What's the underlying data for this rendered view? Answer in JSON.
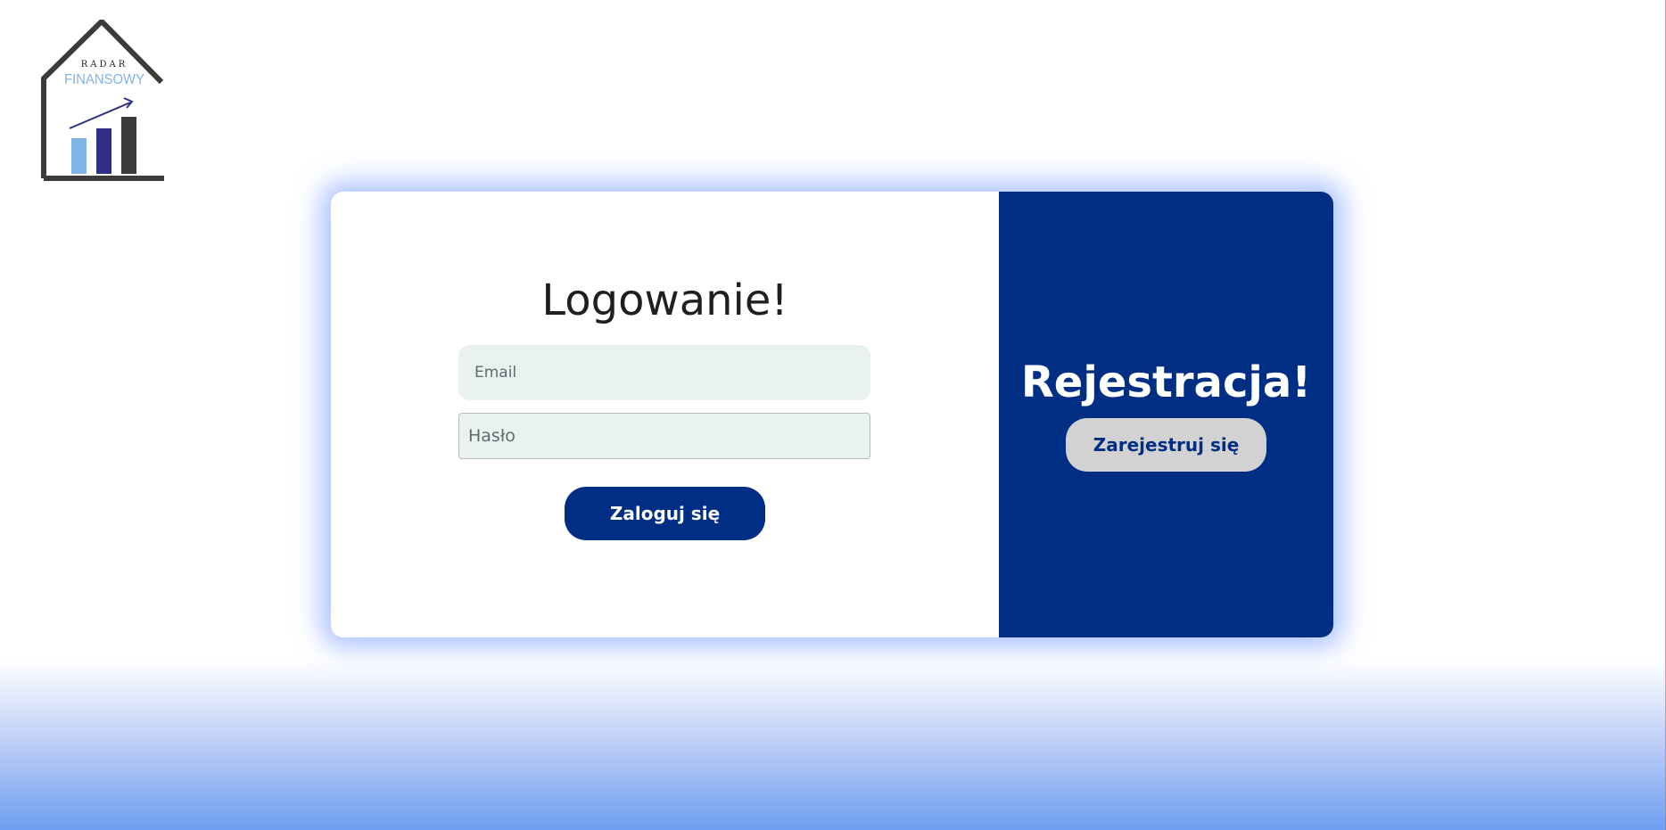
{
  "logo": {
    "top_text": "RADAR",
    "bottom_text": "FINANSOWY"
  },
  "login": {
    "title": "Logowanie!",
    "email_placeholder": "Email",
    "password_placeholder": "Hasło",
    "submit_label": "Zaloguj się"
  },
  "register": {
    "title": "Rejestracja!",
    "button_label": "Zarejestruj się"
  },
  "colors": {
    "primary": "#002e85",
    "input_background": "#eaf2f1",
    "secondary_button": "#d2d2d2",
    "logo_light_blue": "#7fb4e8",
    "logo_dark_blue": "#2f2f86",
    "logo_dark_gray": "#3b3b3b"
  }
}
